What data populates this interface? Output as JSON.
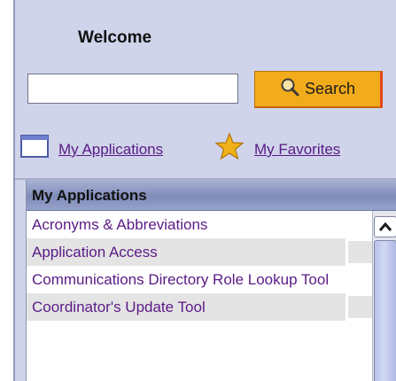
{
  "welcome": "Welcome",
  "search": {
    "placeholder": "",
    "value": "",
    "button_label": "Search"
  },
  "nav": {
    "apps_label": "My Applications",
    "fav_label": "My Favorites"
  },
  "box": {
    "header": "My Applications",
    "items": [
      {
        "label": "Acronyms & Abbreviations",
        "shaded": false
      },
      {
        "label": "Application Access",
        "shaded": true
      },
      {
        "label": "Communications Directory Role Lookup Tool",
        "shaded": false
      },
      {
        "label": "Coordinator's Update Tool",
        "shaded": true
      }
    ]
  },
  "colors": {
    "panel": "#cfd4ea",
    "search_button": "#f2ab1a",
    "link": "#5a1a86",
    "row_shade": "#e4e4e4"
  },
  "icons": [
    "magnifier-icon",
    "window-icon",
    "star-icon",
    "scroll-up-arrow-icon"
  ]
}
